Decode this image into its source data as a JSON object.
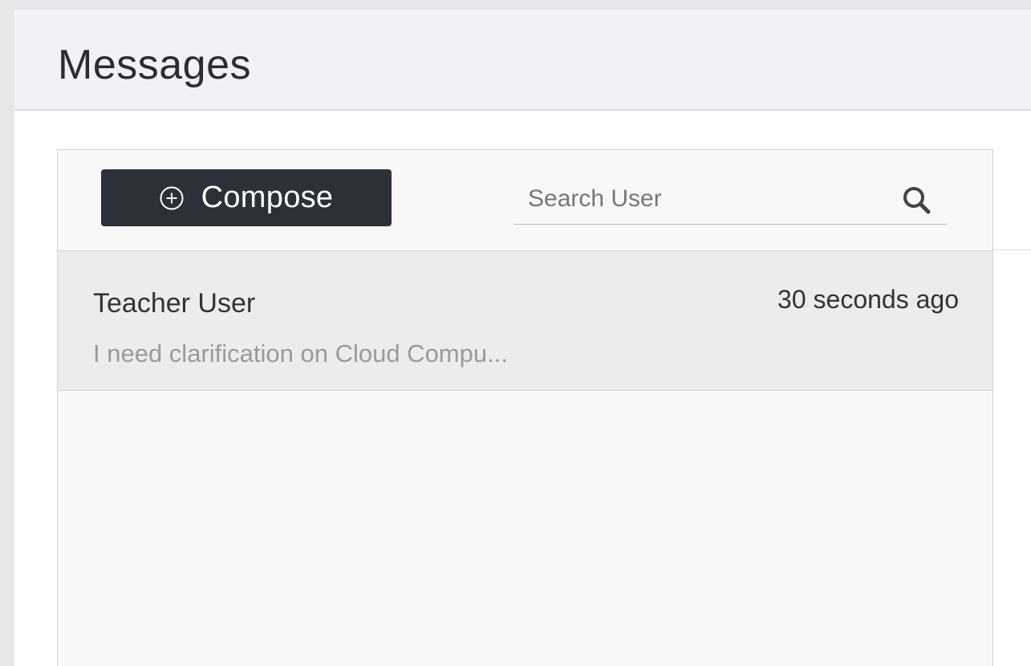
{
  "page": {
    "title": "Messages"
  },
  "toolbar": {
    "compose_label": "Compose",
    "compose_icon": "plus-circle-icon",
    "search_placeholder": "Search User",
    "search_icon": "search-icon"
  },
  "messages": [
    {
      "sender": "Teacher User",
      "time": "30 seconds ago",
      "preview": "I need clarification on Cloud Compu..."
    }
  ],
  "colors": {
    "compose_bg": "#2c3038",
    "header_bg": "#f1f2f5",
    "selected_row_bg": "#ececec",
    "preview_text": "#9a9a9a"
  }
}
